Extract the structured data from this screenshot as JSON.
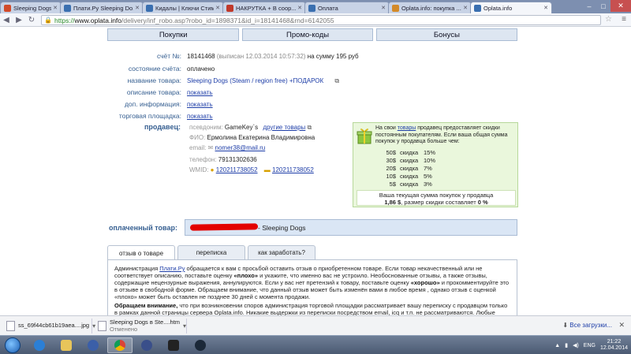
{
  "browser": {
    "tabs": [
      {
        "label": "Sleeping Dogs аукци...",
        "active": false,
        "fav_color": "#d14a2a"
      },
      {
        "label": "Плати.Ру Sleeping Do...",
        "active": false,
        "fav_color": "#3a6fb0"
      },
      {
        "label": "Кидалы | Ключи Стим...",
        "active": false,
        "fav_color": "#3a6fb0"
      },
      {
        "label": "НАКРУТКА + В соор...",
        "active": false,
        "fav_color": "#c0392b"
      },
      {
        "label": "Оплата",
        "active": false,
        "fav_color": "#3a6fb0"
      },
      {
        "label": "Oplata.info: покупка ...",
        "active": false,
        "fav_color": "#d38a2a"
      },
      {
        "label": "Oplata.info",
        "active": true,
        "fav_color": "#3a6fb0"
      }
    ],
    "url_scheme": "https://",
    "url_host": "www.oplata.info",
    "url_rest": "/delivery/inf_robo.asp?robo_id=1898371&id_i=18141468&rnd=6142055"
  },
  "nav": {
    "tabs": [
      "Покупки",
      "Промо-коды",
      "Бонусы"
    ]
  },
  "invoice": {
    "number_label": "счёт №:",
    "number": "18141468",
    "issued": "(выписан 12.03.2014 10:57:32)",
    "amount": "на сумму 195 руб",
    "status_label": "состояние счёта:",
    "status": "оплачено",
    "product_label": "название товара:",
    "product": "Sleeping Dogs (Steam / region free) +ПОДАРОК",
    "desc_label": "описание товара:",
    "desc_link": "показать",
    "extra_label": "доп. информация:",
    "extra_link": "показать",
    "market_label": "торговая площадка:",
    "market_link": "показать"
  },
  "seller": {
    "label": "продавец:",
    "alias_label": "псевдоним:",
    "alias": "GameKey`s",
    "other_link": "другие товары",
    "fio_label": "ФИО:",
    "fio": "Ермолина Екатерина Владимировна",
    "email_label": "email:",
    "email": "nomer38@mail.ru",
    "phone_label": "телефон:",
    "phone": "79131302636",
    "wmid_label": "WMID:",
    "wmid1": "120211738052",
    "wmid2": "120211738052"
  },
  "discount": {
    "text_before": "На свои ",
    "text_link": "товары",
    "text_after": " продавец предоставляет скидки постоянным покупателям. Если ваша общая сумма покупок у продавца больше чем:",
    "word": "скидка",
    "rows": [
      {
        "amount": "50$",
        "pct": "15%"
      },
      {
        "amount": "30$",
        "pct": "10%"
      },
      {
        "amount": "20$",
        "pct": "7%"
      },
      {
        "amount": "10$",
        "pct": "5%"
      },
      {
        "amount": "5$",
        "pct": "3%"
      }
    ],
    "total_line1": "Ваша текущая сумма покупок у продавца",
    "total_value": "1,86 $",
    "total_line2_mid": ", размер скидки составляет ",
    "total_pct": "0 %"
  },
  "paid": {
    "label": "оплаченный товар:",
    "value": "- Sleeping Dogs"
  },
  "content_tabs": [
    "отзыв о товаре",
    "переписка",
    "как заработать?"
  ],
  "review": {
    "p1_a": "Администрация ",
    "p1_link": "Плати.Ру",
    "p1_b": " обращается к вам с просьбой оставить отзыв о приобретенном товаре. Если товар некачественный или не соответствует описанию, поставьте оценку ",
    "p1_bad": "«плохо»",
    "p1_c": " и укажите, что именно вас не устроило. Необоснованные отзывы, а также отзывы, содержащие нецензурные выражения, аннулируются. Если у вас нет претензий к товару, поставьте оценку ",
    "p1_good": "«хорошо»",
    "p1_d": " и прокомментируйте это в отзыве в свободной форме. Обращаем внимание, что данный отзыв может быть изменён вами в любое время , однако отзыв с оценкой «плохо» может быть оставлен не позднее 30 дней с момента продажи.",
    "p2_bold": "Обращаем внимание,",
    "p2_text": " что при возникновении споров администрация торговой площадки рассматривает вашу переписку с продавцом только в рамках данной страницы сервера Oplata.info. Никакие выдержки из переписки посредством email, icq и т.п. не рассматриваются. Любые просьбы продавца вести переписку по отзыву через внешние системы обмена сообщениями настоятельно рекомендуем игнорировать!"
  },
  "downloads": {
    "items": [
      {
        "name": "ss_69f44cb61b19aea....jpg",
        "status": ""
      },
      {
        "name": "Sleeping Dogs в Ste....htm",
        "status": "Отменено"
      }
    ],
    "all_label": "Все загрузки..."
  },
  "taskbar": {
    "lang": "ENG",
    "time": "21:22",
    "date": "12.04.2014"
  }
}
